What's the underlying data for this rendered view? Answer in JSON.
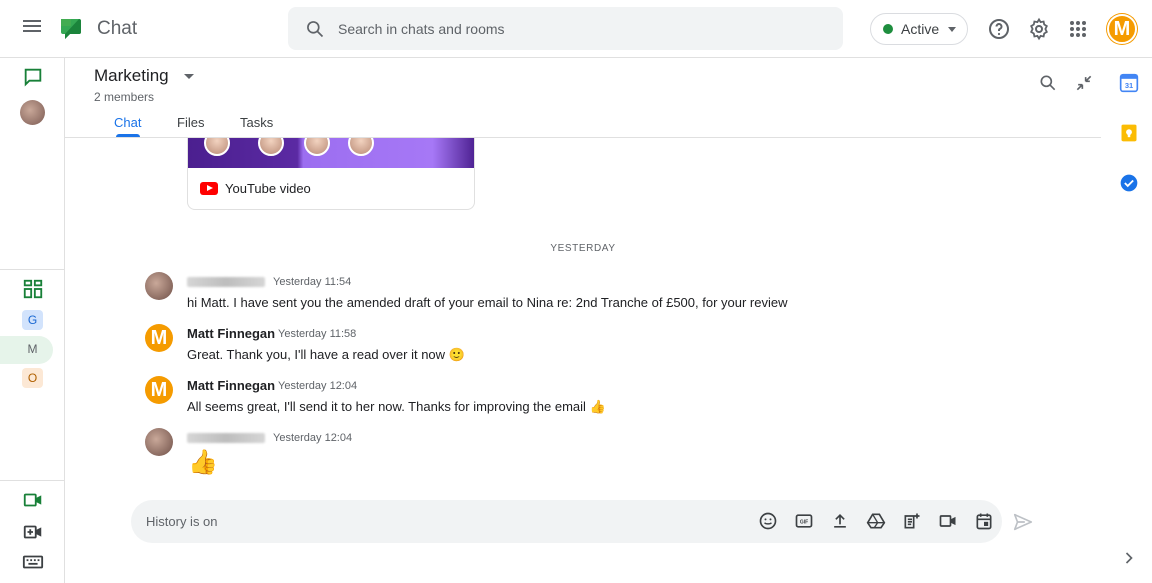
{
  "app": {
    "title": "Chat"
  },
  "search": {
    "placeholder": "Search in chats and rooms"
  },
  "status": {
    "label": "Active",
    "color": "#1e8e3e"
  },
  "account": {
    "initial": "M",
    "color": "#f59b00"
  },
  "rail": {
    "rooms": [
      {
        "letter": "G",
        "bg": "#d2e3fc",
        "fg": "#1967d2"
      },
      {
        "letter": "M",
        "bg": "#e6f4ea",
        "fg": "#5f6368"
      },
      {
        "letter": "O",
        "bg": "#fce8d5",
        "fg": "#b06000"
      }
    ]
  },
  "room": {
    "title": "Marketing",
    "subtitle": "2 members",
    "tabs": [
      {
        "label": "Chat",
        "active": true
      },
      {
        "label": "Files",
        "active": false
      },
      {
        "label": "Tasks",
        "active": false
      }
    ]
  },
  "card": {
    "label": "YouTube video"
  },
  "divider": "YESTERDAY",
  "messages": [
    {
      "sender": "",
      "sender_hidden": true,
      "time": "Yesterday 11:54",
      "text": "hi Matt. I have sent you the amended draft of your email to Nina re:  2nd Tranche of £500, for your review"
    },
    {
      "sender": "Matt Finnegan",
      "time": "Yesterday 11:58",
      "text": "Great. Thank you, I'll have a read over it now 🙂"
    },
    {
      "sender": "Matt Finnegan",
      "time": "Yesterday 12:04",
      "text": "All seems great, I'll send it to her now. Thanks for improving the email 👍"
    },
    {
      "sender": "",
      "sender_hidden": true,
      "time": "Yesterday 12:04",
      "text": "👍"
    }
  ],
  "composer": {
    "placeholder": "History is on"
  },
  "colors": {
    "accent": "#1a73e8",
    "brand_green": "#34a853"
  }
}
